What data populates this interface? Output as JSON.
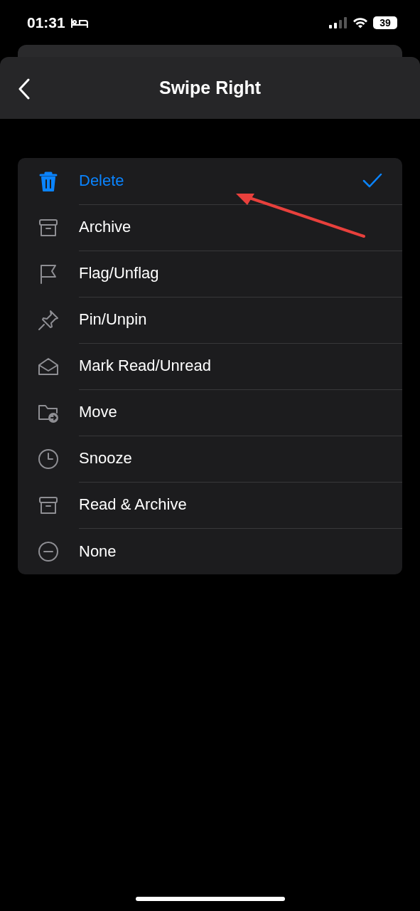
{
  "status_bar": {
    "time": "01:31",
    "battery": "39"
  },
  "header": {
    "title": "Swipe Right"
  },
  "options": [
    {
      "label": "Delete",
      "kind": "trash",
      "selected": true
    },
    {
      "label": "Archive",
      "kind": "archive",
      "selected": false
    },
    {
      "label": "Flag/Unflag",
      "kind": "flag",
      "selected": false
    },
    {
      "label": "Pin/Unpin",
      "kind": "pin",
      "selected": false
    },
    {
      "label": "Mark Read/Unread",
      "kind": "envelope",
      "selected": false
    },
    {
      "label": "Move",
      "kind": "folder",
      "selected": false
    },
    {
      "label": "Snooze",
      "kind": "clock",
      "selected": false
    },
    {
      "label": "Read & Archive",
      "kind": "archive",
      "selected": false
    },
    {
      "label": "None",
      "kind": "minus",
      "selected": false
    }
  ]
}
